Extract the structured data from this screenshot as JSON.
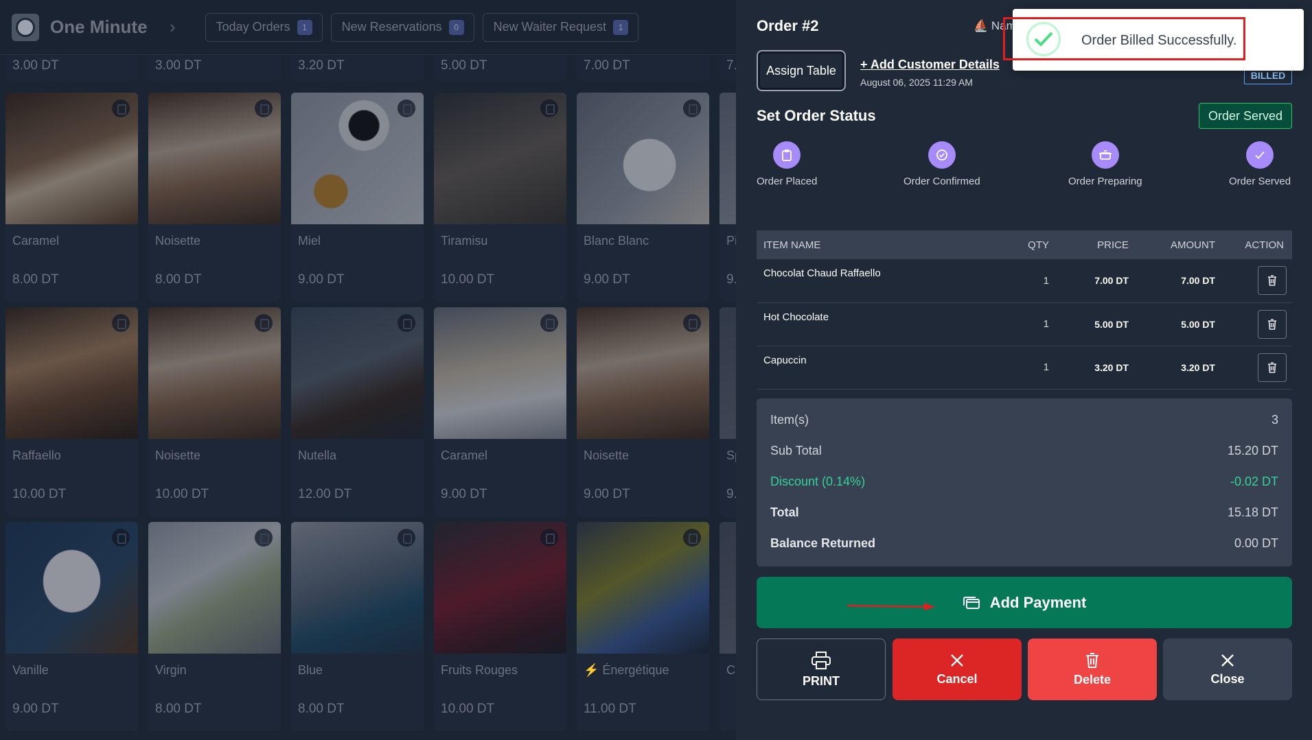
{
  "app": {
    "name": "One Minute",
    "nav": [
      {
        "label": "Today Orders",
        "count": "1"
      },
      {
        "label": "New Reservations",
        "count": "0"
      },
      {
        "label": "New Waiter Request",
        "count": "1"
      }
    ],
    "top_prices": [
      "3.00 DT",
      "3.00 DT",
      "3.20 DT",
      "5.00 DT",
      "7.00 DT",
      "7."
    ],
    "menu_rows": [
      [
        {
          "name": "Caramel",
          "price": "8.00 DT"
        },
        {
          "name": "Noisette",
          "price": "8.00 DT"
        },
        {
          "name": "Miel",
          "price": "9.00 DT"
        },
        {
          "name": "Tiramisu",
          "price": "10.00 DT"
        },
        {
          "name": "Blanc Blanc",
          "price": "9.00 DT"
        },
        {
          "name": "Pi",
          "price": "9."
        }
      ],
      [
        {
          "name": "Raffaello",
          "price": "10.00 DT"
        },
        {
          "name": "Noisette",
          "price": "10.00 DT"
        },
        {
          "name": "Nutella",
          "price": "12.00 DT"
        },
        {
          "name": "Caramel",
          "price": "9.00 DT"
        },
        {
          "name": "Noisette",
          "price": "9.00 DT"
        },
        {
          "name": "Sp",
          "price": "9."
        }
      ],
      [
        {
          "name": "Vanille",
          "price": "9.00 DT"
        },
        {
          "name": "Virgin",
          "price": "8.00 DT"
        },
        {
          "name": "Blue",
          "price": "8.00 DT"
        },
        {
          "name": "Fruits Rouges",
          "price": "10.00 DT"
        },
        {
          "name": "⚡ Énergétique",
          "price": "11.00 DT"
        },
        {
          "name": "Cr",
          "price": ""
        }
      ]
    ]
  },
  "order": {
    "title": "Order #2",
    "waiter_partial": "Nam",
    "assign_table": "Assign Table",
    "add_customer": "+ Add Customer Details",
    "date": "August 06, 2025 11:29 AM",
    "badge": "BILLED",
    "status_title": "Set Order Status",
    "status_button": "Order Served",
    "steps": [
      "Order Placed",
      "Order Confirmed",
      "Order Preparing",
      "Order Served"
    ],
    "table": {
      "headers": [
        "ITEM NAME",
        "QTY",
        "PRICE",
        "AMOUNT",
        "ACTION"
      ],
      "rows": [
        {
          "name": "Chocolat Chaud Raffaello",
          "qty": "1",
          "price": "7.00 DT",
          "amount": "7.00 DT"
        },
        {
          "name": "Hot Chocolate",
          "qty": "1",
          "price": "5.00 DT",
          "amount": "5.00 DT"
        },
        {
          "name": "Capuccin",
          "qty": "1",
          "price": "3.20 DT",
          "amount": "3.20 DT"
        }
      ]
    },
    "summary": [
      {
        "label": "Item(s)",
        "value": "3"
      },
      {
        "label": "Sub Total",
        "value": "15.20 DT"
      },
      {
        "label": "Discount (0.14%)",
        "value": "-0.02 DT"
      },
      {
        "label": "Total",
        "value": "15.18 DT"
      },
      {
        "label": "Balance Returned",
        "value": "0.00 DT"
      }
    ],
    "add_payment": "Add Payment",
    "actions": {
      "print": "PRINT",
      "cancel": "Cancel",
      "delete": "Delete",
      "close": "Close"
    }
  },
  "toast": {
    "message": "Order Billed Successfully."
  },
  "colors": {
    "panel_bg": "#1f2937",
    "accent_purple": "#a78bfa",
    "payment_green": "#047857",
    "cancel_red": "#dc2626",
    "delete_red": "#ef4444",
    "success_green": "#22c55e"
  }
}
